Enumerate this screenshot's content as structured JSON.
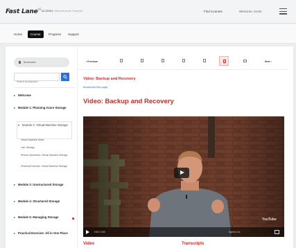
{
  "header": {
    "logo": "Fast Lane",
    "logo_sup": "US",
    "course_code": "AZ-800DA",
    "course_title": "Microsoft Azure Transcript",
    "find_courses": "Find Courses",
    "welcome": "Welcome, Kevin"
  },
  "nav": {
    "items": [
      "Home",
      "Course",
      "Progress",
      "Support"
    ],
    "active": "Course"
  },
  "sidebar": {
    "bookmarks_label": "Bookmarks",
    "search_placeholder": "Search by keyword...",
    "toc": [
      {
        "label": "Welcome",
        "state": "collapsed"
      },
      {
        "label": "Module 1: Planning Azure Storage",
        "state": "collapsed"
      },
      {
        "label": "Module 2: Virtual Machine Storage",
        "state": "expanded"
      },
      {
        "label": "Module 3: Unstructured Storage",
        "state": "collapsed"
      },
      {
        "label": "Module 4: Structured Storage",
        "state": "collapsed"
      },
      {
        "label": "Module 5: Managing Storage",
        "state": "collapsed"
      },
      {
        "label": "Practical Exercise: All in One Place",
        "state": "collapsed"
      }
    ],
    "subitems": [
      "Virtual Machine Disks",
      "Lab: Storage",
      "Review Questions: Virtual Machine Storage",
      "Practical Exercise: Virtual Machine Storage"
    ]
  },
  "toolbar": {
    "previous": "Previous",
    "next": "Next",
    "icons": [
      "page-icon",
      "page-icon",
      "page-icon",
      "page-icon",
      "page-icon",
      "video-icon",
      "document-icon"
    ]
  },
  "content": {
    "breadcrumb_title": "Video: Backup and Recovery",
    "bookmark_link": "Bookmark this page",
    "title": "Video: Backup and Recovery",
    "video": {
      "time": "0:00 / 0:00",
      "speed": "Speed 1.0x",
      "youtube_label": "YouTube"
    },
    "section_video": "Video",
    "section_transcripts": "Transcripts"
  },
  "colors": {
    "accent_red": "#c4302b",
    "link_blue": "#2e6fd6",
    "nav_active_bg": "#111111"
  }
}
